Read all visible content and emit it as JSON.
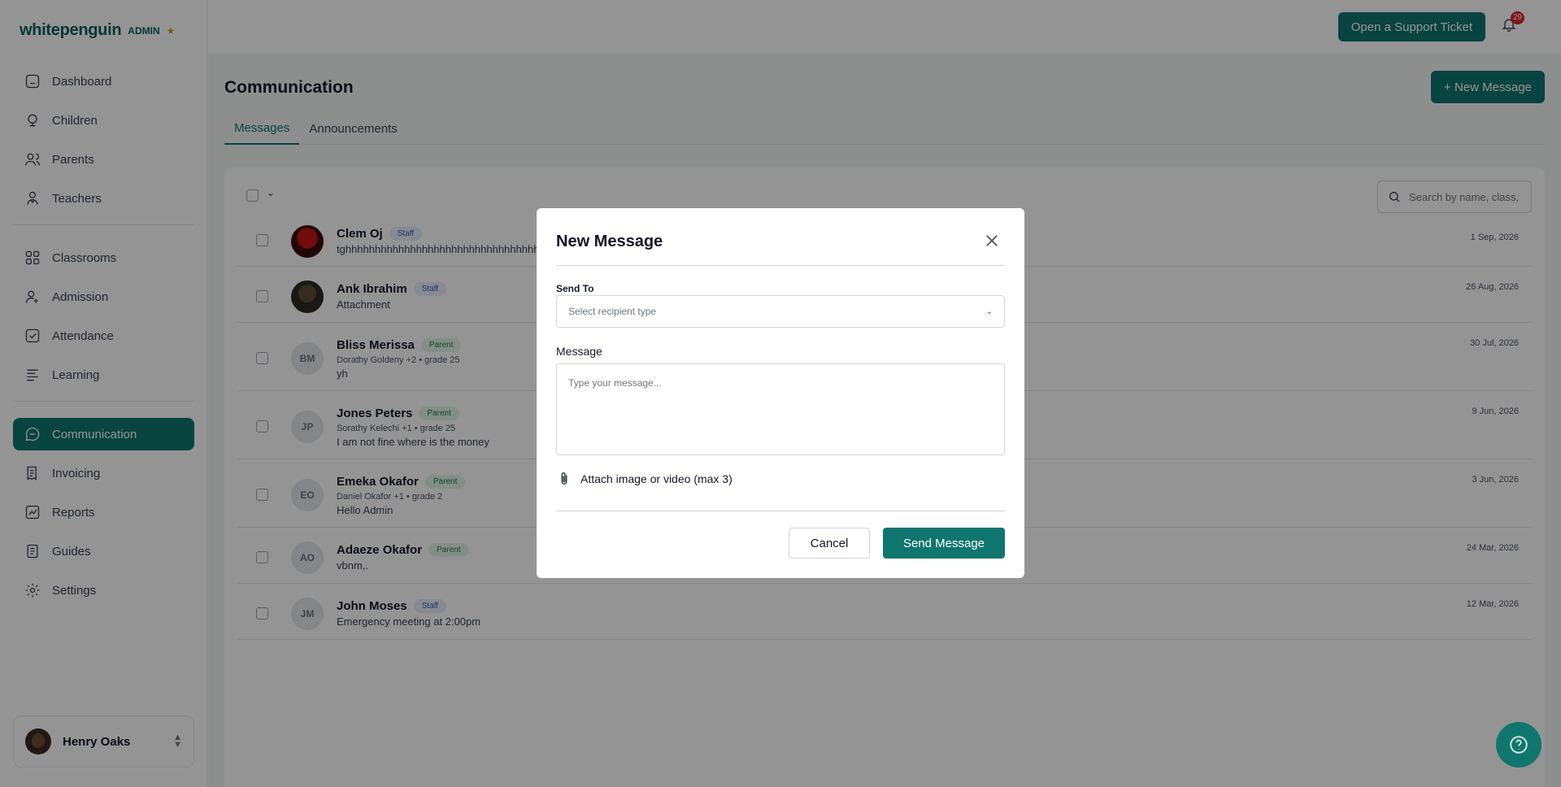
{
  "brand": {
    "name": "whitepenguin",
    "role": "ADMIN",
    "badge_icon": "admin-badge-icon"
  },
  "sidebar": {
    "primary": [
      {
        "label": "Dashboard",
        "icon": "dashboard-icon"
      },
      {
        "label": "Children",
        "icon": "children-icon"
      },
      {
        "label": "Parents",
        "icon": "parents-icon"
      },
      {
        "label": "Teachers",
        "icon": "teachers-icon"
      }
    ],
    "secondary": [
      {
        "label": "Classrooms",
        "icon": "classrooms-icon"
      },
      {
        "label": "Admission",
        "icon": "admission-icon"
      },
      {
        "label": "Attendance",
        "icon": "attendance-icon"
      },
      {
        "label": "Learning",
        "icon": "learning-icon"
      }
    ],
    "tertiary": [
      {
        "label": "Communication",
        "icon": "communication-icon",
        "active": true
      },
      {
        "label": "Invoicing",
        "icon": "invoicing-icon"
      },
      {
        "label": "Reports",
        "icon": "reports-icon"
      },
      {
        "label": "Guides",
        "icon": "guides-icon"
      },
      {
        "label": "Settings",
        "icon": "settings-icon"
      }
    ],
    "user": {
      "name": "Henry Oaks"
    }
  },
  "topbar": {
    "support_label": "Open a Support Ticket",
    "notification_count": "29"
  },
  "page": {
    "title": "Communication",
    "new_message_label": "+ New Message",
    "tabs": [
      {
        "label": "Messages",
        "active": true
      },
      {
        "label": "Announcements",
        "active": false
      }
    ],
    "search_placeholder": "Search by name, class, …"
  },
  "messages": [
    {
      "name": "Clem Oj",
      "role": "Staff",
      "avatar": "photo-red",
      "initials": "",
      "sub": "",
      "preview": "tghhhhhhhhhhhhhhhhhhhhhhhhhhhhhhhhhhhhh",
      "date": "1 Sep, 2026"
    },
    {
      "name": "Ank Ibrahim",
      "role": "Staff",
      "avatar": "photo-dark",
      "initials": "",
      "sub": "",
      "preview": "Attachment",
      "date": "26 Aug, 2026"
    },
    {
      "name": "Bliss Merissa",
      "role": "Parent",
      "avatar": "initials",
      "initials": "BM",
      "sub": "Dorathy Goldeny +2 • grade 25",
      "preview": "yh",
      "date": "30 Jul, 2026"
    },
    {
      "name": "Jones Peters",
      "role": "Parent",
      "avatar": "initials",
      "initials": "JP",
      "sub": "Sorathy Kelechi +1 • grade 25",
      "preview": "I am not fine where is the money",
      "date": "9 Jun, 2026"
    },
    {
      "name": "Emeka Okafor",
      "role": "Parent",
      "avatar": "initials",
      "initials": "EO",
      "sub": "Daniel Okafor +1 • grade 2",
      "preview": "Hello Admin",
      "date": "3 Jun, 2026"
    },
    {
      "name": "Adaeze Okafor",
      "role": "Parent",
      "avatar": "initials",
      "initials": "AO",
      "sub": "",
      "preview": "vbnm,.",
      "date": "24 Mar, 2026"
    },
    {
      "name": "John Moses",
      "role": "Staff",
      "avatar": "initials",
      "initials": "JM",
      "sub": "",
      "preview": "Emergency meeting at 2:00pm",
      "date": "12 Mar, 2026"
    }
  ],
  "modal": {
    "title": "New Message",
    "send_to_label": "Send To",
    "send_to_placeholder": "Select recipient type",
    "message_label": "Message",
    "message_placeholder": "Type your message...",
    "attach_label": "Attach image or video (max 3)",
    "cancel_label": "Cancel",
    "send_label": "Send Message"
  },
  "colors": {
    "primary": "#0f766e",
    "overlay": "rgba(0,0,0,0.42)"
  }
}
